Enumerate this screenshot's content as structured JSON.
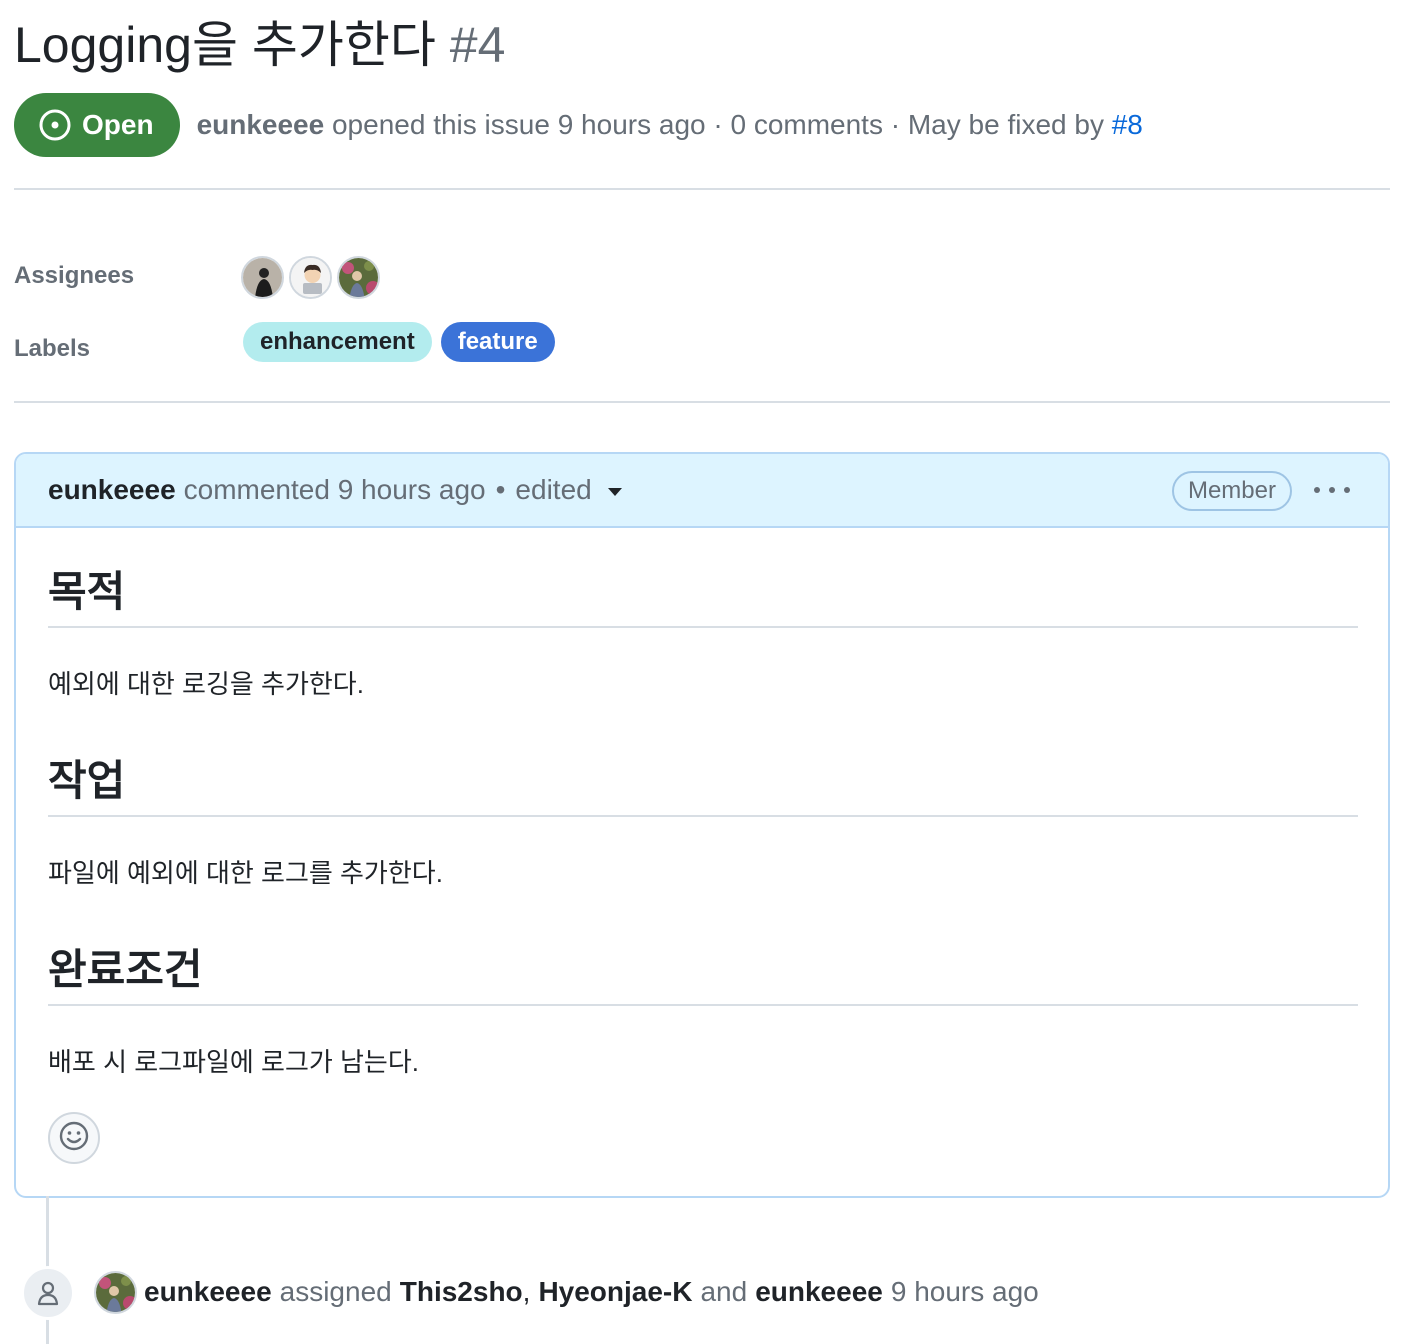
{
  "issue": {
    "title": "Logging을 추가한다",
    "number": "#4",
    "state": "Open",
    "author": "eunkeeee",
    "opened_text": "opened this issue 9 hours ago · 0 comments · May be fixed by",
    "fixed_by": "#8"
  },
  "properties": {
    "assignees_label": "Assignees",
    "labels_label": "Labels",
    "labels": [
      {
        "name": "enhancement",
        "bg": "#b3ecee",
        "fg": "#1f2328"
      },
      {
        "name": "feature",
        "bg": "#3b73d8",
        "fg": "#ffffff"
      }
    ]
  },
  "comment": {
    "author": "eunkeeee",
    "meta": "commented 9 hours ago",
    "dot": "•",
    "edited": "edited",
    "role_badge": "Member",
    "sections": [
      {
        "heading": "목적",
        "text": "예외에 대한 로깅을 추가한다."
      },
      {
        "heading": "작업",
        "text": "파일에 예외에 대한 로그를 추가한다."
      },
      {
        "heading": "완료조건",
        "text": "배포 시 로그파일에 로그가 남는다."
      }
    ]
  },
  "timeline": {
    "actor": "eunkeeee",
    "action": "assigned",
    "target1": "This2sho",
    "sep": ",",
    "target2": "Hyeonjae-K",
    "and": "and",
    "target3": "eunkeeee",
    "time": "9 hours ago"
  },
  "colors": {
    "open_green": "#3b8640",
    "link_blue": "#0969da",
    "comment_header_bg": "#ddf4ff"
  },
  "icons": [
    "issue-open-icon",
    "smiley-icon",
    "person-icon",
    "kebab-horizontal-icon",
    "triangle-down-icon"
  ]
}
